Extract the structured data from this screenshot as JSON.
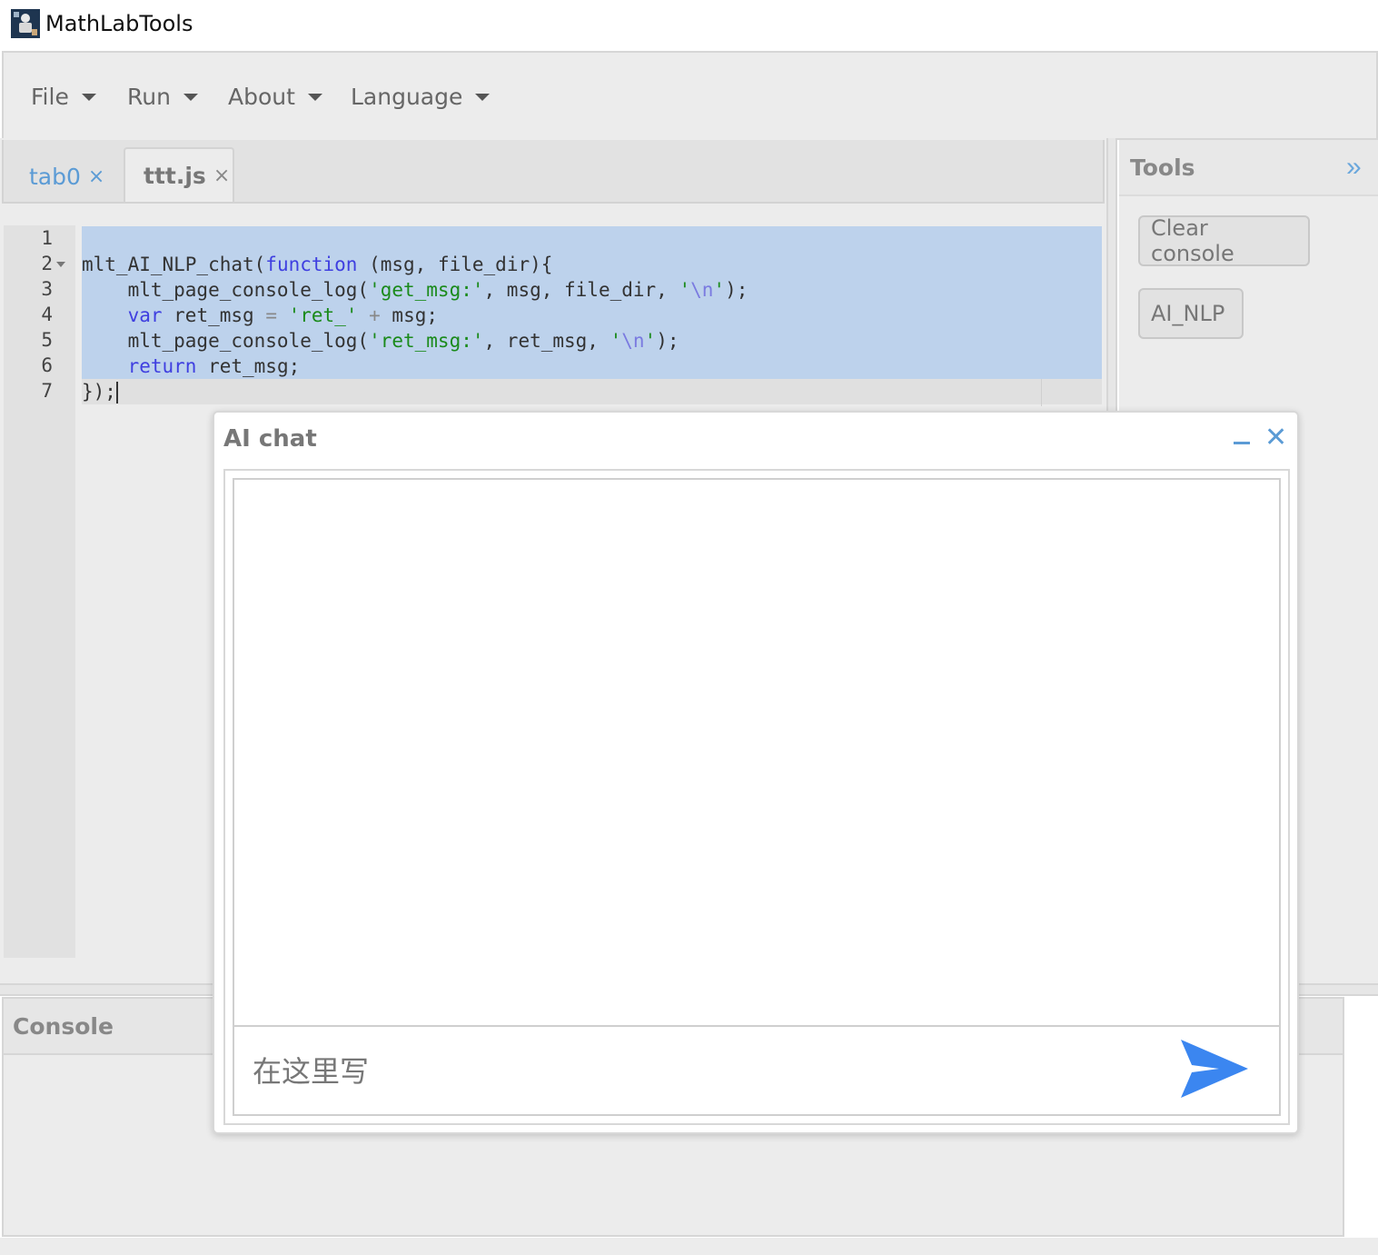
{
  "window": {
    "title": "MathLabTools",
    "icon": "app-logo-icon"
  },
  "menubar": {
    "items": [
      {
        "label": "File"
      },
      {
        "label": "Run"
      },
      {
        "label": "About"
      },
      {
        "label": "Language"
      }
    ]
  },
  "editor": {
    "tabs": [
      {
        "label": "tab0",
        "close": "×",
        "active": false
      },
      {
        "label": "ttt.js",
        "close": "×",
        "active": true
      }
    ],
    "line_numbers": [
      "1",
      "2",
      "3",
      "4",
      "5",
      "6",
      "7"
    ],
    "code": {
      "l2_a": "mlt_AI_NLP_chat(",
      "l2_kw": "function",
      "l2_b": " (msg, file_dir){",
      "l3_a": "    mlt_page_console_log(",
      "l3_s1": "'get_msg:'",
      "l3_b": ", msg, file_dir, ",
      "l3_q1": "'",
      "l3_esc": "\\n",
      "l3_q2": "'",
      "l3_c": ");",
      "l4_kw": "    var",
      "l4_a": " ret_msg ",
      "l4_op1": "=",
      "l4_b": " ",
      "l4_s": "'ret_'",
      "l4_op2": " +",
      "l4_c": " msg;",
      "l5_a": "    mlt_page_console_log(",
      "l5_s1": "'ret_msg:'",
      "l5_b": ", ret_msg, ",
      "l5_q1": "'",
      "l5_esc": "\\n",
      "l5_q2": "'",
      "l5_c": ");",
      "l6_kw": "    return",
      "l6_a": " ret_msg;",
      "l7_a": "});"
    }
  },
  "tools": {
    "title": "Tools",
    "collapse_glyph": "»",
    "buttons": [
      {
        "label": "Clear console"
      },
      {
        "label": "AI_NLP"
      }
    ]
  },
  "console": {
    "title": "Console"
  },
  "ai_chat": {
    "title": "AI chat",
    "input_placeholder": "在这里写",
    "close_glyph": "✕",
    "send_color": "#3b86f0"
  }
}
